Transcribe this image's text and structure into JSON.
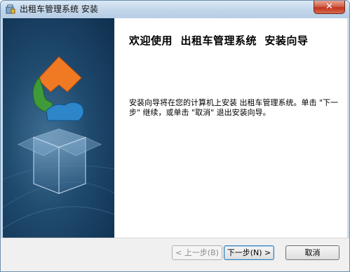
{
  "window": {
    "title": "出租车管理系统 安装",
    "close_symbol": "✕"
  },
  "welcome": {
    "heading": "欢迎使用  出租车管理系统  安装向导",
    "description": "安装向导将在您的计算机上安装 出租车管理系统。单击 \"下一步\" 继续，或单击 \"取消\" 退出安装向导。"
  },
  "buttons": {
    "back": "< 上一步(B)",
    "next": "下一步(N) >",
    "cancel": "取消"
  }
}
